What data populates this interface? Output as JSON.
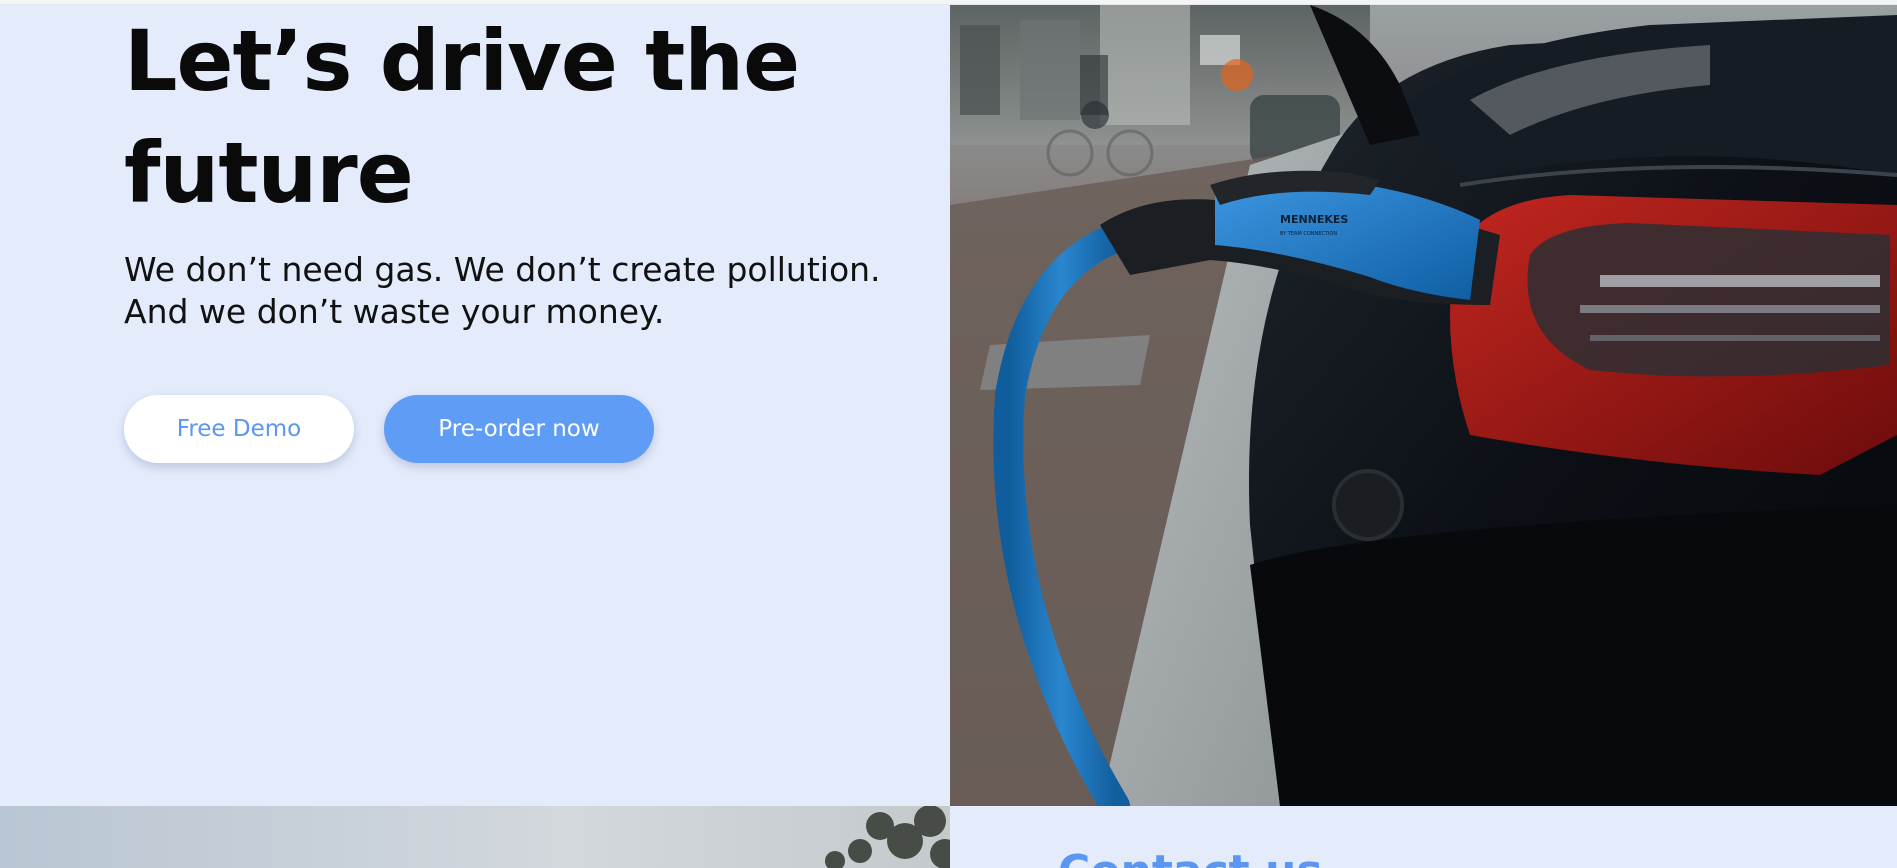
{
  "hero": {
    "title": "Let’s drive the future",
    "subtitle": "We don’t need gas. We don’t create pollution. And we don’t waste your money.",
    "buttons": {
      "free_demo": "Free Demo",
      "preorder": "Pre-order now"
    },
    "image": {
      "plug_brand": "MENNEKES",
      "plug_tagline": "BY TEAM CONNECTION"
    }
  },
  "contact": {
    "heading": "Contact us"
  },
  "colors": {
    "hero_background": "#e4ecfc",
    "accent": "#5f9cf6",
    "title_text": "#0a0a0a"
  }
}
